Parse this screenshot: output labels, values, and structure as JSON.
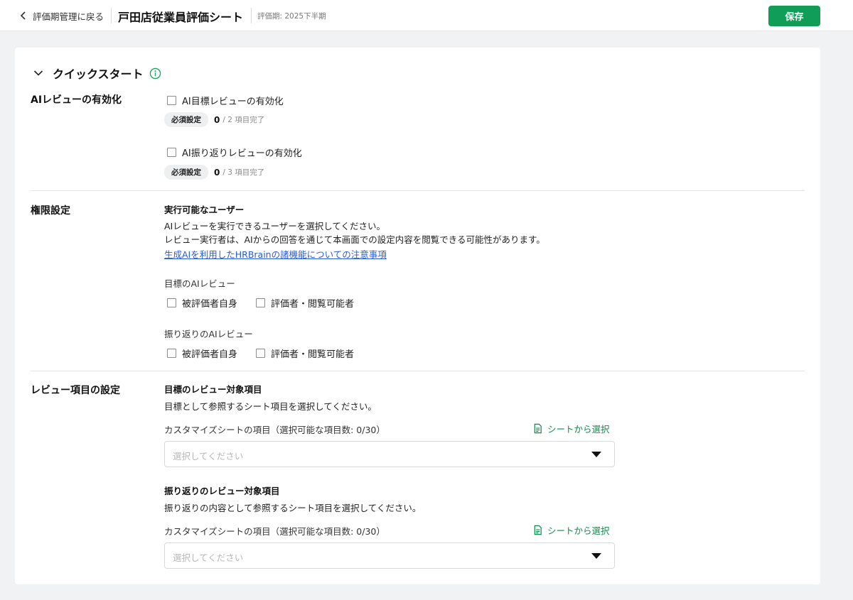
{
  "header": {
    "back_label": "評価期管理に戻る",
    "title": "戸田店従業員評価シート",
    "period": "評価期: 2025下半期",
    "save_label": "保存"
  },
  "quickstart": {
    "title": "クイックスタート"
  },
  "ai_review": {
    "section_label": "AIレビューの有効化",
    "goal": {
      "label": "AI目標レビューの有効化",
      "badge": "必須設定",
      "done": "0",
      "total": "/ 2 項目完了"
    },
    "reflection": {
      "label": "AI振り返りレビューの有効化",
      "badge": "必須設定",
      "done": "0",
      "total": "/ 3 項目完了"
    }
  },
  "permissions": {
    "section_label": "権限設定",
    "subtitle": "実行可能なユーザー",
    "desc1": "AIレビューを実行できるユーザーを選択してください。",
    "desc2": "レビュー実行者は、AIからの回答を通じて本画面での設定内容を閲覧できる可能性があります。",
    "link": "生成AIを利用したHRBrainの諸機能についての注意事項",
    "goal_group": {
      "label": "目標のAIレビュー",
      "opt1": "被評価者自身",
      "opt2": "評価者・閲覧可能者"
    },
    "reflection_group": {
      "label": "振り返りのAIレビュー",
      "opt1": "被評価者自身",
      "opt2": "評価者・閲覧可能者"
    }
  },
  "review_items": {
    "section_label": "レビュー項目の設定",
    "goal": {
      "title": "目標のレビュー対象項目",
      "desc": "目標として参照するシート項目を選択してください。",
      "field_label": "カスタマイズシートの項目（選択可能な項目数: 0/30）",
      "select_link": "シートから選択",
      "placeholder": "選択してください"
    },
    "reflection": {
      "title": "振り返りのレビュー対象項目",
      "desc": "振り返りの内容として参照するシート項目を選択してください。",
      "field_label": "カスタマイズシートの項目（選択可能な項目数: 0/30）",
      "select_link": "シートから選択",
      "placeholder": "選択してください"
    }
  },
  "colors": {
    "primary_green": "#0f9d58",
    "link_blue": "#2a5bd7",
    "info_green": "#1aa260"
  },
  "icons": [
    "chevron-left-icon",
    "chevron-down-icon",
    "info-icon",
    "document-icon",
    "caret-down-icon"
  ]
}
